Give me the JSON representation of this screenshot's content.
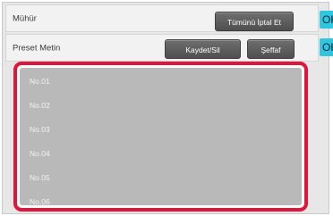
{
  "rows": {
    "stamp": {
      "label": "Mühür",
      "cancel_all": "Tümünü İptal Et",
      "ok": "OK"
    },
    "preset_text": {
      "label": "Preset Metin",
      "save_delete": "Kaydet/Sil",
      "transparent": "Şeffaf",
      "ok": "OK"
    }
  },
  "preset_list": {
    "items": [
      "No.01",
      "No.02",
      "No.03",
      "No.04",
      "No.05",
      "No.06"
    ]
  },
  "colors": {
    "highlight": "#e0153a",
    "ok_accent": "#2fc7e0",
    "button": "#5a5a5a",
    "list_bg": "#b9b9b9"
  }
}
